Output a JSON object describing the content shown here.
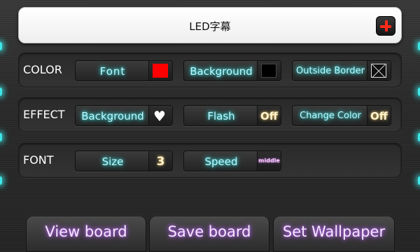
{
  "header": {
    "title": "LED字幕"
  },
  "color_row": {
    "label": "COLOR",
    "font_label": "Font",
    "background_label": "Background",
    "outside_border_label": "Outside Border"
  },
  "effect_row": {
    "label": "EFFECT",
    "background_label": "Background",
    "background_value": "♥",
    "flash_label": "Flash",
    "flash_value": "Off",
    "change_color_label": "Change Color",
    "change_color_value": "Off"
  },
  "font_row": {
    "label": "FONT",
    "size_label": "Size",
    "size_value": "3",
    "speed_label": "Speed",
    "speed_value": "middle"
  },
  "bottom": {
    "view_board": "View board",
    "save_board": "Save board",
    "set_wallpaper": "Set Wallpaper"
  },
  "colors": {
    "font_color": "#ff0000",
    "background_color": "#000000",
    "label_glow": "#3ee6e6",
    "button_glow": "#c26bff"
  }
}
